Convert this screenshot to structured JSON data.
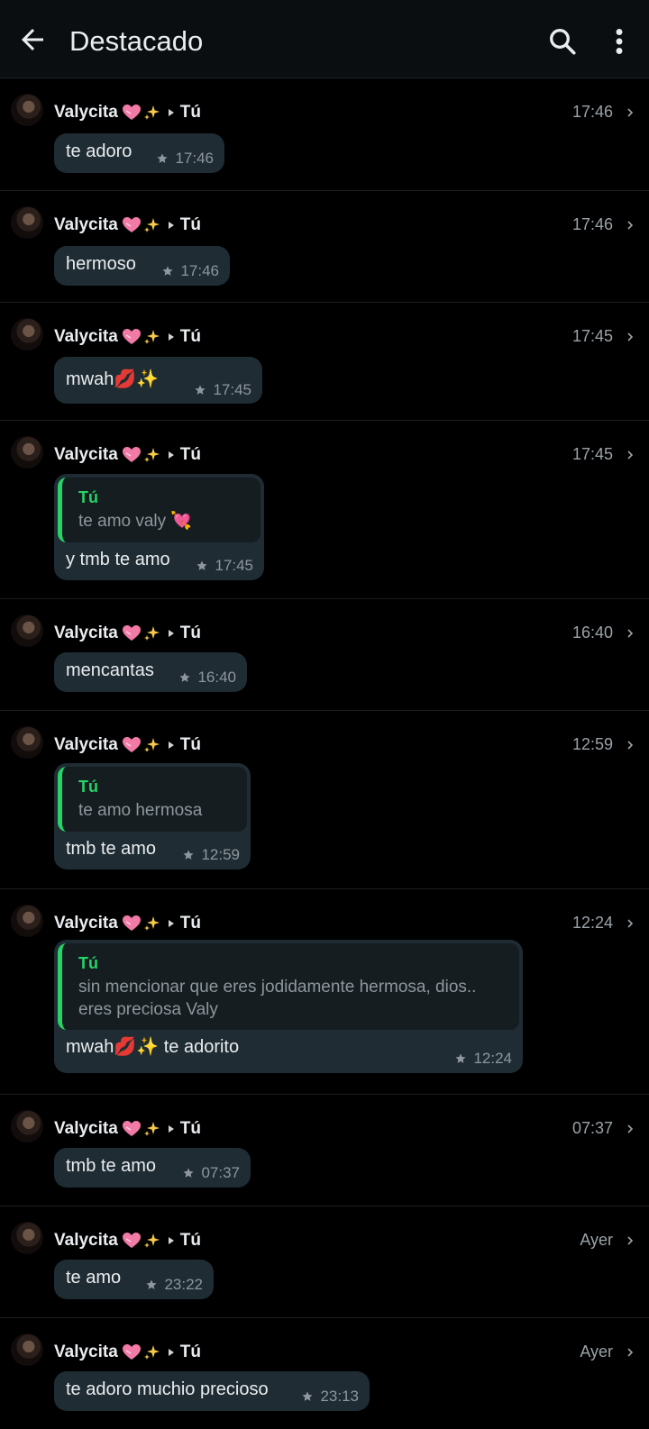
{
  "header": {
    "title": "Destacado"
  },
  "messages": [
    {
      "sender": "Valycita",
      "recipient": "Tú",
      "time": "17:46",
      "text": "te adoro",
      "star_time": "17:46"
    },
    {
      "sender": "Valycita",
      "recipient": "Tú",
      "time": "17:46",
      "text": "hermoso",
      "star_time": "17:46"
    },
    {
      "sender": "Valycita",
      "recipient": "Tú",
      "time": "17:45",
      "text": "mwah💋✨",
      "star_time": "17:45"
    },
    {
      "sender": "Valycita",
      "recipient": "Tú",
      "time": "17:45",
      "quote_author": "Tú",
      "quote_text": "te amo valy 💘",
      "text": "y tmb te amo",
      "star_time": "17:45"
    },
    {
      "sender": "Valycita",
      "recipient": "Tú",
      "time": "16:40",
      "text": "mencantas",
      "star_time": "16:40"
    },
    {
      "sender": "Valycita",
      "recipient": "Tú",
      "time": "12:59",
      "quote_author": "Tú",
      "quote_text": "te amo hermosa",
      "text": "tmb te amo",
      "star_time": "12:59"
    },
    {
      "sender": "Valycita",
      "recipient": "Tú",
      "time": "12:24",
      "quote_author": "Tú",
      "quote_text": "sin mencionar que eres jodidamente hermosa, dios..\neres preciosa Valy",
      "text": "mwah💋✨ te adorito",
      "star_time": "12:24"
    },
    {
      "sender": "Valycita",
      "recipient": "Tú",
      "time": "07:37",
      "text": "tmb te amo",
      "star_time": "07:37"
    },
    {
      "sender": "Valycita",
      "recipient": "Tú",
      "time": "Ayer",
      "text": "te amo",
      "star_time": "23:22"
    },
    {
      "sender": "Valycita",
      "recipient": "Tú",
      "time": "Ayer",
      "text": "te adoro muchio precioso",
      "star_time": "23:13"
    }
  ],
  "colors": {
    "accent": "#25d366",
    "bubble": "#1f2c33",
    "background": "#000000"
  },
  "icons": [
    "back-arrow-icon",
    "search-icon",
    "more-vert-icon",
    "star-icon",
    "chevron-right-icon",
    "heart-emoji-icon",
    "sparkles-emoji-icon"
  ]
}
